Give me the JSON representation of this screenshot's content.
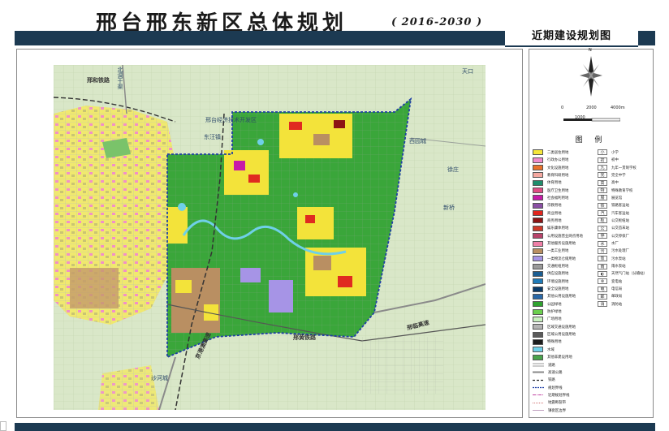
{
  "title": {
    "main": "邢台邢东新区总体规划",
    "years": "( 2016-2030 )",
    "subtitle": "近期建设规划图"
  },
  "colors": {
    "header_bar": "#1c3a52",
    "background_farmland": "#d9e7c8",
    "new_district_boundary": "#1f3fa6",
    "park_green": "#3aa63a"
  },
  "map_labels": {
    "railway_west": "邢和铁路",
    "road_north": "北调干渠",
    "econ_zone": "邢台经济技术开发区",
    "dwang": "东汪镇",
    "railway_south": "邢黄铁路",
    "road_sw": "京港澳高速",
    "road_se": "邢临高速",
    "town_e1": "西园城",
    "town_e2": "徐庄",
    "town_e3": "新桥",
    "town_n": "天口",
    "town_sw": "沙河城"
  },
  "north_arrow": {
    "label": "N"
  },
  "scale": {
    "ticks": [
      "0",
      "2000",
      "4000m"
    ],
    "sub": "1000"
  },
  "legend": {
    "title": "图  例",
    "land_use": [
      {
        "label": "二类居住用地",
        "color": "#f5e63a"
      },
      {
        "label": "行政办公用地",
        "color": "#f08acb"
      },
      {
        "label": "文化设施用地",
        "color": "#e8712a"
      },
      {
        "label": "教育科研用地",
        "color": "#f4a8a0"
      },
      {
        "label": "体育用地",
        "color": "#1f8d6c"
      },
      {
        "label": "医疗卫生用地",
        "color": "#e04c84"
      },
      {
        "label": "社会福利用地",
        "color": "#c71aa8"
      },
      {
        "label": "宗教用地",
        "color": "#8a4fa4"
      },
      {
        "label": "商业用地",
        "color": "#e0261e"
      },
      {
        "label": "商务用地",
        "color": "#8c1414"
      },
      {
        "label": "娱乐康体用地",
        "color": "#cf3a2a"
      },
      {
        "label": "公用设施营业网点用地",
        "color": "#b8436a"
      },
      {
        "label": "其他服务设施用地",
        "color": "#ef80a8"
      },
      {
        "label": "一类工业用地",
        "color": "#b98f62"
      },
      {
        "label": "一类物流仓储用地",
        "color": "#a694e6"
      },
      {
        "label": "交通枢纽用地",
        "color": "#9a9a9a"
      },
      {
        "label": "供应设施用地",
        "color": "#1c5e92"
      },
      {
        "label": "环境设施用地",
        "color": "#1f7bb8"
      },
      {
        "label": "安全设施用地",
        "color": "#0a3b6a"
      },
      {
        "label": "其他公用设施用地",
        "color": "#2968a8"
      },
      {
        "label": "公园绿地",
        "color": "#2fa22f"
      },
      {
        "label": "防护绿地",
        "color": "#6bcf4e"
      },
      {
        "label": "广场用地",
        "color": "#c9f0c0"
      },
      {
        "label": "区域交通设施用地",
        "color": "#b4b4b4"
      },
      {
        "label": "区域公用设施用地",
        "color": "#5a5a5a"
      },
      {
        "label": "特殊用地",
        "color": "#1d1d1d"
      },
      {
        "label": "水域",
        "color": "#6fd0e8"
      },
      {
        "label": "其他非建设用地",
        "color": "#49a34b"
      }
    ],
    "lines": [
      {
        "label": "道路"
      },
      {
        "label": "高速公路"
      },
      {
        "label": "铁路"
      },
      {
        "label": "规划界线"
      },
      {
        "label": "近期规划界线"
      },
      {
        "label": "地震断裂带"
      },
      {
        "label": "镇街区边界"
      }
    ],
    "facilities": [
      {
        "label": "小学",
        "glyph": "小"
      },
      {
        "label": "初中",
        "glyph": "初"
      },
      {
        "label": "九年一贯制学校",
        "glyph": "九"
      },
      {
        "label": "完全中学",
        "glyph": "完"
      },
      {
        "label": "高中",
        "glyph": "高"
      },
      {
        "label": "特殊教育学校",
        "glyph": "特"
      },
      {
        "label": "展览馆",
        "glyph": "展"
      },
      {
        "label": "铁路客运站",
        "glyph": "铁"
      },
      {
        "label": "汽车客运站",
        "glyph": "汽"
      },
      {
        "label": "公交枢纽站",
        "glyph": "枢"
      },
      {
        "label": "公交首末站",
        "glyph": "公"
      },
      {
        "label": "公交停保厂",
        "glyph": "停"
      },
      {
        "label": "水厂",
        "glyph": "水"
      },
      {
        "label": "污水处理厂",
        "glyph": "污"
      },
      {
        "label": "污水泵站",
        "glyph": "泵"
      },
      {
        "label": "雨水泵站",
        "glyph": "雨"
      },
      {
        "label": "天然气门站（分输站）",
        "glyph": "◐"
      },
      {
        "label": "变电站",
        "glyph": "⊗"
      },
      {
        "label": "电信局",
        "glyph": "电"
      },
      {
        "label": "邮政局",
        "glyph": "邮"
      },
      {
        "label": "消防站",
        "glyph": "消"
      }
    ]
  }
}
